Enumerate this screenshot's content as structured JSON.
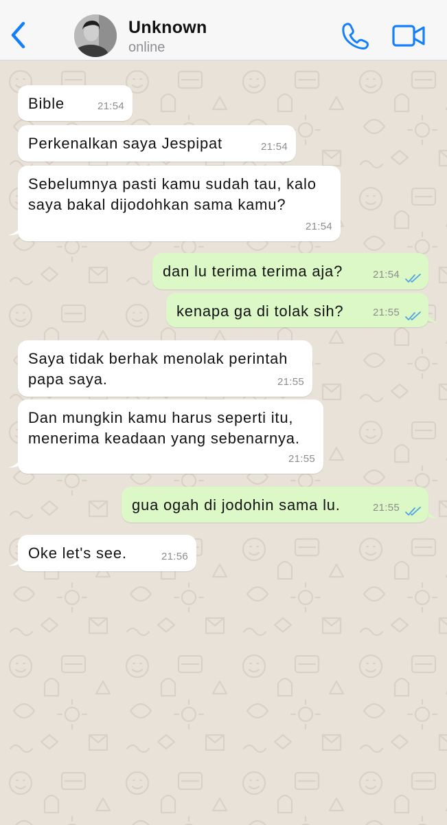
{
  "header": {
    "contact_name": "Unknown",
    "status": "online",
    "icons": {
      "back": "chevron-left-icon",
      "call": "phone-icon",
      "video": "video-camera-icon"
    }
  },
  "colors": {
    "accent": "#147efb",
    "incoming_bubble": "#ffffff",
    "outgoing_bubble": "#dcf8c6",
    "read_ticks": "#4fa3e0",
    "wallpaper": "#e8e2d9"
  },
  "messages": [
    {
      "direction": "in",
      "lines": [
        "Bible"
      ],
      "time": "21:54"
    },
    {
      "direction": "in",
      "lines": [
        "Perkenalkan saya Jespipat"
      ],
      "time": "21:54"
    },
    {
      "direction": "in",
      "lines": [
        "Sebelumnya pasti kamu sudah tau, kalo",
        "saya bakal dijodohkan sama kamu?"
      ],
      "time": "21:54"
    },
    {
      "direction": "out",
      "lines": [
        "dan lu terima terima aja?"
      ],
      "time": "21:54",
      "read": true
    },
    {
      "direction": "out",
      "lines": [
        "kenapa ga di tolak sih?"
      ],
      "time": "21:55",
      "read": true
    },
    {
      "direction": "in",
      "lines": [
        "Saya tidak berhak menolak perintah",
        "papa saya."
      ],
      "time": "21:55"
    },
    {
      "direction": "in",
      "lines": [
        "Dan mungkin kamu harus seperti itu,",
        "menerima keadaan yang sebenarnya."
      ],
      "time": "21:55"
    },
    {
      "direction": "out",
      "lines": [
        "gua ogah di jodohin sama lu."
      ],
      "time": "21:55",
      "read": true
    },
    {
      "direction": "in",
      "lines": [
        "Oke let's see."
      ],
      "time": "21:56"
    }
  ]
}
